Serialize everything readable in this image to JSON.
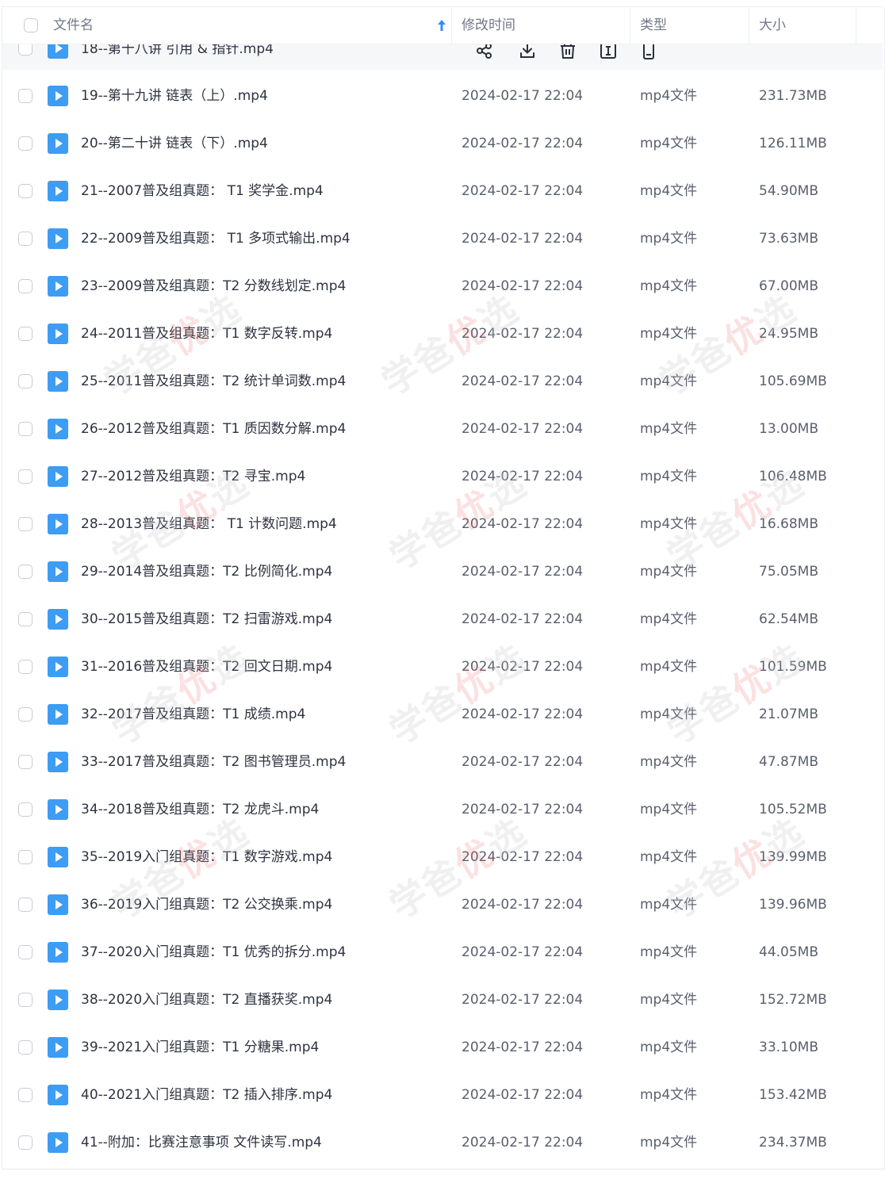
{
  "header": {
    "name_label": "文件名",
    "time_label": "修改时间",
    "type_label": "类型",
    "size_label": "大小"
  },
  "hover_row": {
    "name": "18--第十八讲 引用 & 指针.mp4"
  },
  "rows": [
    {
      "name": "19--第十九讲 链表（上）.mp4",
      "time": "2024-02-17 22:04",
      "type": "mp4文件",
      "size": "231.73MB"
    },
    {
      "name": "20--第二十讲 链表（下）.mp4",
      "time": "2024-02-17 22:04",
      "type": "mp4文件",
      "size": "126.11MB"
    },
    {
      "name": "21--2007普及组真题：  T1 奖学金.mp4",
      "time": "2024-02-17 22:04",
      "type": "mp4文件",
      "size": "54.90MB"
    },
    {
      "name": "22--2009普及组真题：  T1 多项式输出.mp4",
      "time": "2024-02-17 22:04",
      "type": "mp4文件",
      "size": "73.63MB"
    },
    {
      "name": "23--2009普及组真题：T2 分数线划定.mp4",
      "time": "2024-02-17 22:04",
      "type": "mp4文件",
      "size": "67.00MB"
    },
    {
      "name": "24--2011普及组真题：T1 数字反转.mp4",
      "time": "2024-02-17 22:04",
      "type": "mp4文件",
      "size": "24.95MB"
    },
    {
      "name": "25--2011普及组真题：T2 统计单词数.mp4",
      "time": "2024-02-17 22:04",
      "type": "mp4文件",
      "size": "105.69MB"
    },
    {
      "name": "26--2012普及组真题：T1 质因数分解.mp4",
      "time": "2024-02-17 22:04",
      "type": "mp4文件",
      "size": "13.00MB"
    },
    {
      "name": "27--2012普及组真题：T2 寻宝.mp4",
      "time": "2024-02-17 22:04",
      "type": "mp4文件",
      "size": "106.48MB"
    },
    {
      "name": "28--2013普及组真题：  T1 计数问题.mp4",
      "time": "2024-02-17 22:04",
      "type": "mp4文件",
      "size": "16.68MB"
    },
    {
      "name": "29--2014普及组真题：T2 比例简化.mp4",
      "time": "2024-02-17 22:04",
      "type": "mp4文件",
      "size": "75.05MB"
    },
    {
      "name": "30--2015普及组真题：T2 扫雷游戏.mp4",
      "time": "2024-02-17 22:04",
      "type": "mp4文件",
      "size": "62.54MB"
    },
    {
      "name": "31--2016普及组真题：T2 回文日期.mp4",
      "time": "2024-02-17 22:04",
      "type": "mp4文件",
      "size": "101.59MB"
    },
    {
      "name": "32--2017普及组真题：T1 成绩.mp4",
      "time": "2024-02-17 22:04",
      "type": "mp4文件",
      "size": "21.07MB"
    },
    {
      "name": "33--2017普及组真题：T2 图书管理员.mp4",
      "time": "2024-02-17 22:04",
      "type": "mp4文件",
      "size": "47.87MB"
    },
    {
      "name": "34--2018普及组真题：T2 龙虎斗.mp4",
      "time": "2024-02-17 22:04",
      "type": "mp4文件",
      "size": "105.52MB"
    },
    {
      "name": "35--2019入门组真题：T1 数字游戏.mp4",
      "time": "2024-02-17 22:04",
      "type": "mp4文件",
      "size": "139.99MB"
    },
    {
      "name": "36--2019入门组真题：T2 公交换乘.mp4",
      "time": "2024-02-17 22:04",
      "type": "mp4文件",
      "size": "139.96MB"
    },
    {
      "name": "37--2020入门组真题：T1 优秀的拆分.mp4",
      "time": "2024-02-17 22:04",
      "type": "mp4文件",
      "size": "44.05MB"
    },
    {
      "name": "38--2020入门组真题：T2 直播获奖.mp4",
      "time": "2024-02-17 22:04",
      "type": "mp4文件",
      "size": "152.72MB"
    },
    {
      "name": "39--2021入门组真题：T1 分糖果.mp4",
      "time": "2024-02-17 22:04",
      "type": "mp4文件",
      "size": "33.10MB"
    },
    {
      "name": "40--2021入门组真题：T2 插入排序.mp4",
      "time": "2024-02-17 22:04",
      "type": "mp4文件",
      "size": "153.42MB"
    },
    {
      "name": "41--附加：比赛注意事项 文件读写.mp4",
      "time": "2024-02-17 22:04",
      "type": "mp4文件",
      "size": "234.37MB"
    }
  ],
  "watermark": {
    "a": "学爸",
    "b": "优",
    "c": "选"
  },
  "colors": {
    "accent": "#2f8ef6",
    "file_icon": "#3d9cf3"
  }
}
